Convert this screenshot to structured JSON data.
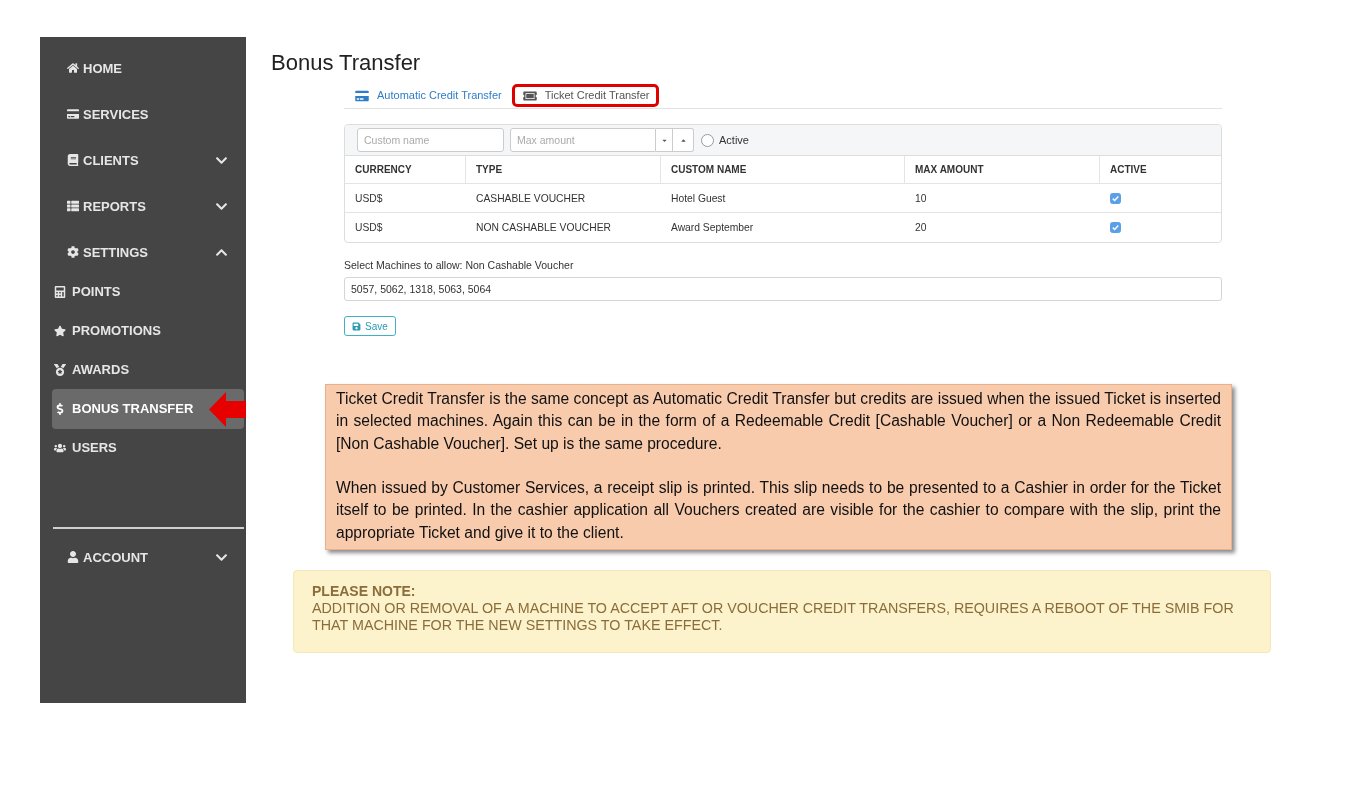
{
  "sidebar": {
    "items": [
      {
        "label": "HOME",
        "kind": "link"
      },
      {
        "label": "SERVICES",
        "kind": "link"
      },
      {
        "label": "CLIENTS",
        "kind": "group",
        "expanded": false
      },
      {
        "label": "REPORTS",
        "kind": "group",
        "expanded": false
      },
      {
        "label": "SETTINGS",
        "kind": "group",
        "expanded": true,
        "children": [
          {
            "label": "POINTS",
            "selected": false,
            "annotated": false
          },
          {
            "label": "PROMOTIONS",
            "selected": false,
            "annotated": false
          },
          {
            "label": "AWARDS",
            "selected": false,
            "annotated": false
          },
          {
            "label": "BONUS TRANSFER",
            "selected": true,
            "annotated": true
          },
          {
            "label": "USERS",
            "selected": false,
            "annotated": false
          }
        ]
      }
    ],
    "account": {
      "label": "ACCOUNT",
      "expanded": false
    }
  },
  "page_title": "Bonus Transfer",
  "tabs": [
    {
      "label": "Automatic Credit Transfer",
      "selected": false,
      "annotated": false
    },
    {
      "label": "Ticket Credit Transfer",
      "selected": true,
      "annotated": true
    }
  ],
  "filter": {
    "custom_name": {
      "placeholder": "Custom name"
    },
    "max_amount": {
      "placeholder": "Max amount"
    },
    "active": {
      "label": "Active",
      "checked": false
    }
  },
  "table": {
    "columns": [
      "CURRENCY",
      "TYPE",
      "CUSTOM NAME",
      "MAX AMOUNT",
      "ACTIVE"
    ],
    "rows": [
      {
        "cells": [
          "USD$",
          "CASHABLE VOUCHER",
          "Hotel Guest",
          "10"
        ],
        "active": true
      },
      {
        "cells": [
          "USD$",
          "NON CASHABLE VOUCHER",
          "Award September",
          "20"
        ],
        "active": true
      }
    ]
  },
  "machines": {
    "label": "Select Machines to allow: Non Cashable Voucher",
    "value": "5057, 5062, 1318, 5063, 5064"
  },
  "save_button": {
    "label": "Save"
  },
  "explanation": {
    "paragraphs": [
      "Ticket Credit Transfer is the same concept as Automatic Credit Transfer but credits are issued when the issued Ticket is inserted in selected machines. Again this can be in the form of a Redeemable Credit [Cashable Voucher] or a Non Redeemable Credit [Non Cashable Voucher]. Set up is the same procedure.",
      "When issued by Customer Services, a receipt slip is printed. This slip needs to be presented to a Cashier in order for the Ticket itself to be printed. In the cashier application all Vouchers created are visible for the cashier to compare with the slip, print the appropriate Ticket and give it to the client."
    ]
  },
  "notice": {
    "title": "PLEASE NOTE:",
    "text": "ADDITION OR REMOVAL OF A MACHINE TO ACCEPT AFT OR VOUCHER CREDIT TRANSFERS, REQUIRES A REBOOT OF THE SMIB FOR THAT MACHINE FOR THE NEW SETTINGS TO TAKE EFFECT."
  }
}
